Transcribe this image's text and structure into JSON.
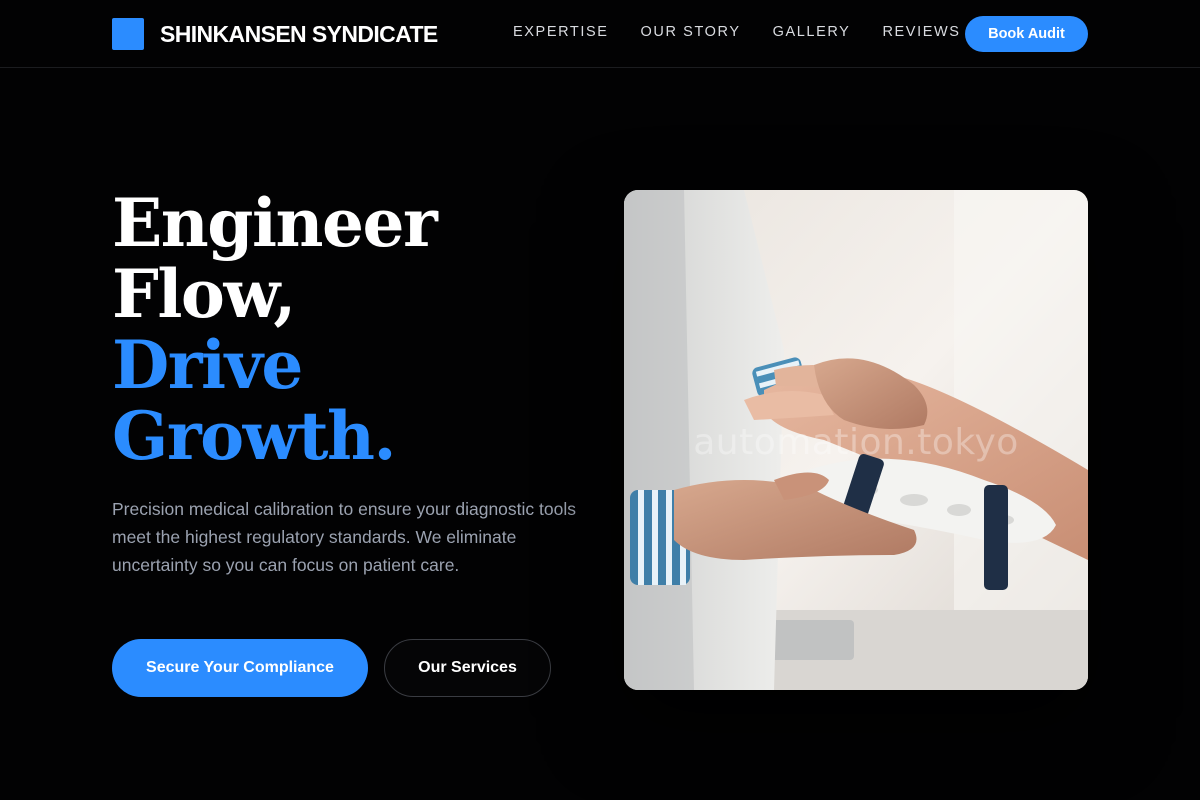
{
  "header": {
    "brand": "SHINKANSEN SYNDICATE",
    "nav": [
      "EXPERTISE",
      "OUR STORY",
      "GALLERY",
      "REVIEWS"
    ],
    "cta_label": "Book Audit"
  },
  "hero": {
    "headline_lines": [
      "Engineer",
      "Flow,",
      "Drive",
      "Growth."
    ],
    "description": "Precision medical calibration to ensure your diagnostic tools meet the highest regulatory standards. We eliminate uncertainty so you can focus on patient care.",
    "primary_cta": "Secure Your Compliance",
    "secondary_cta": "Our Services",
    "image_watermark": "automation.tokyo"
  },
  "colors": {
    "background": "#020203",
    "accent": "#2b8cff",
    "body_text": "#9ba2b0"
  }
}
